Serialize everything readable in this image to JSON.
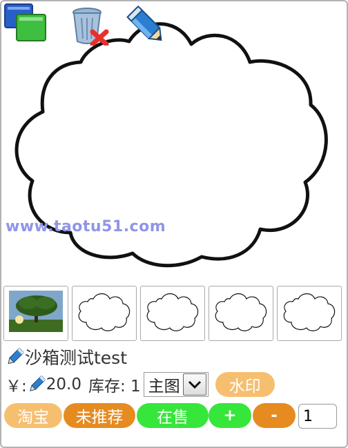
{
  "toolbar": {
    "items": [
      {
        "icon": "windows-icon"
      },
      {
        "icon": "trash-delete-icon"
      },
      {
        "icon": "pencil-icon"
      }
    ]
  },
  "image": {
    "watermark_text": "www.taotu51.com"
  },
  "thumbnails": [
    {
      "kind": "tree-photo"
    },
    {
      "kind": "cloud-outline"
    },
    {
      "kind": "cloud-outline"
    },
    {
      "kind": "cloud-outline"
    },
    {
      "kind": "cloud-outline"
    }
  ],
  "product": {
    "title": "沙箱测试test",
    "price_prefix": "￥:",
    "price": "20.0",
    "stock_label": "库存: 1",
    "image_type_selected": "主图",
    "watermark_button": "水印"
  },
  "actions": {
    "taobao": "淘宝",
    "not_recommended": "未推荐",
    "on_sale": "在售",
    "plus": "+",
    "minus": "-",
    "quantity": "1"
  },
  "colors": {
    "pill_light": "#f6bf6f",
    "pill_orange": "#f0a01c",
    "pill_green": "#36e63a",
    "pencil_blue": "#2a7fd0"
  }
}
